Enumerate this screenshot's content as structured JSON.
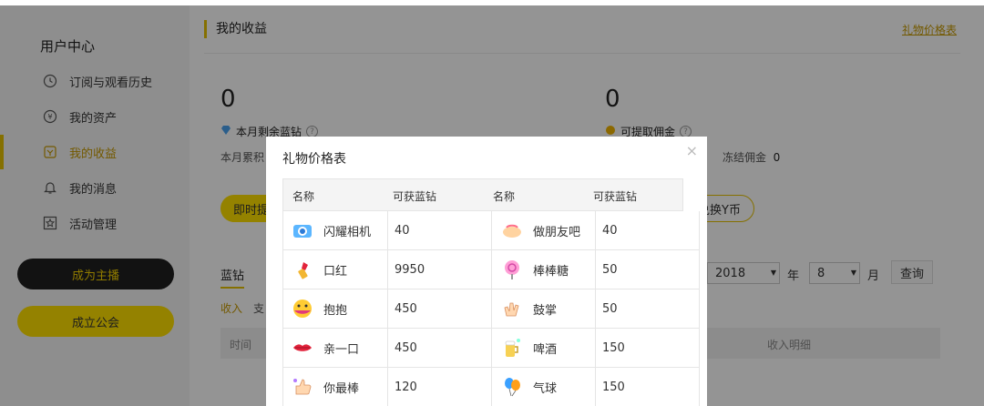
{
  "sidebar": {
    "title": "用户中心",
    "items": [
      {
        "label": "订阅与观看历史",
        "icon": "clock-icon"
      },
      {
        "label": "我的资产",
        "icon": "wallet-icon"
      },
      {
        "label": "我的收益",
        "icon": "income-icon"
      },
      {
        "label": "我的消息",
        "icon": "bell-icon"
      },
      {
        "label": "活动管理",
        "icon": "star-icon"
      }
    ],
    "become_host": "成为主播",
    "found_guild": "成立公会"
  },
  "main": {
    "section_title": "我的收益",
    "gift_price_link": "礼物价格表",
    "left_value": "0",
    "left_label": "本月剩余蓝钻",
    "left_sub": "本月累积",
    "right_value": "0",
    "right_label": "可提取佣金",
    "frozen_label": "冻结佣金",
    "frozen_value": "0",
    "withdraw_now": "即时提",
    "convert_label": "兑换Y币",
    "tab_diamond": "蓝钻",
    "sub_income": "收入",
    "sub_expense": "支",
    "year": "2018",
    "year_unit": "年",
    "month": "8",
    "month_unit": "月",
    "query": "查询",
    "col_time": "时间",
    "col_detail": "收入明细"
  },
  "modal": {
    "title": "礼物价格表",
    "close": "×",
    "headers": [
      "名称",
      "可获蓝钻",
      "名称",
      "可获蓝钻"
    ],
    "rows": [
      [
        {
          "name": "闪耀相机",
          "icon": "camera-icon",
          "value": "40"
        },
        {
          "name": "做朋友吧",
          "icon": "handshake-icon",
          "value": "40"
        }
      ],
      [
        {
          "name": "口红",
          "icon": "lipstick-icon",
          "value": "9950"
        },
        {
          "name": "棒棒糖",
          "icon": "lollipop-icon",
          "value": "50"
        }
      ],
      [
        {
          "name": "抱抱",
          "icon": "hug-icon",
          "value": "450"
        },
        {
          "name": "鼓掌",
          "icon": "clap-icon",
          "value": "50"
        }
      ],
      [
        {
          "name": "亲一口",
          "icon": "lips-icon",
          "value": "450"
        },
        {
          "name": "啤酒",
          "icon": "beer-icon",
          "value": "150"
        }
      ],
      [
        {
          "name": "你最棒",
          "icon": "thumbsup-icon",
          "value": "120"
        },
        {
          "name": "气球",
          "icon": "balloon-icon",
          "value": "150"
        }
      ]
    ]
  }
}
